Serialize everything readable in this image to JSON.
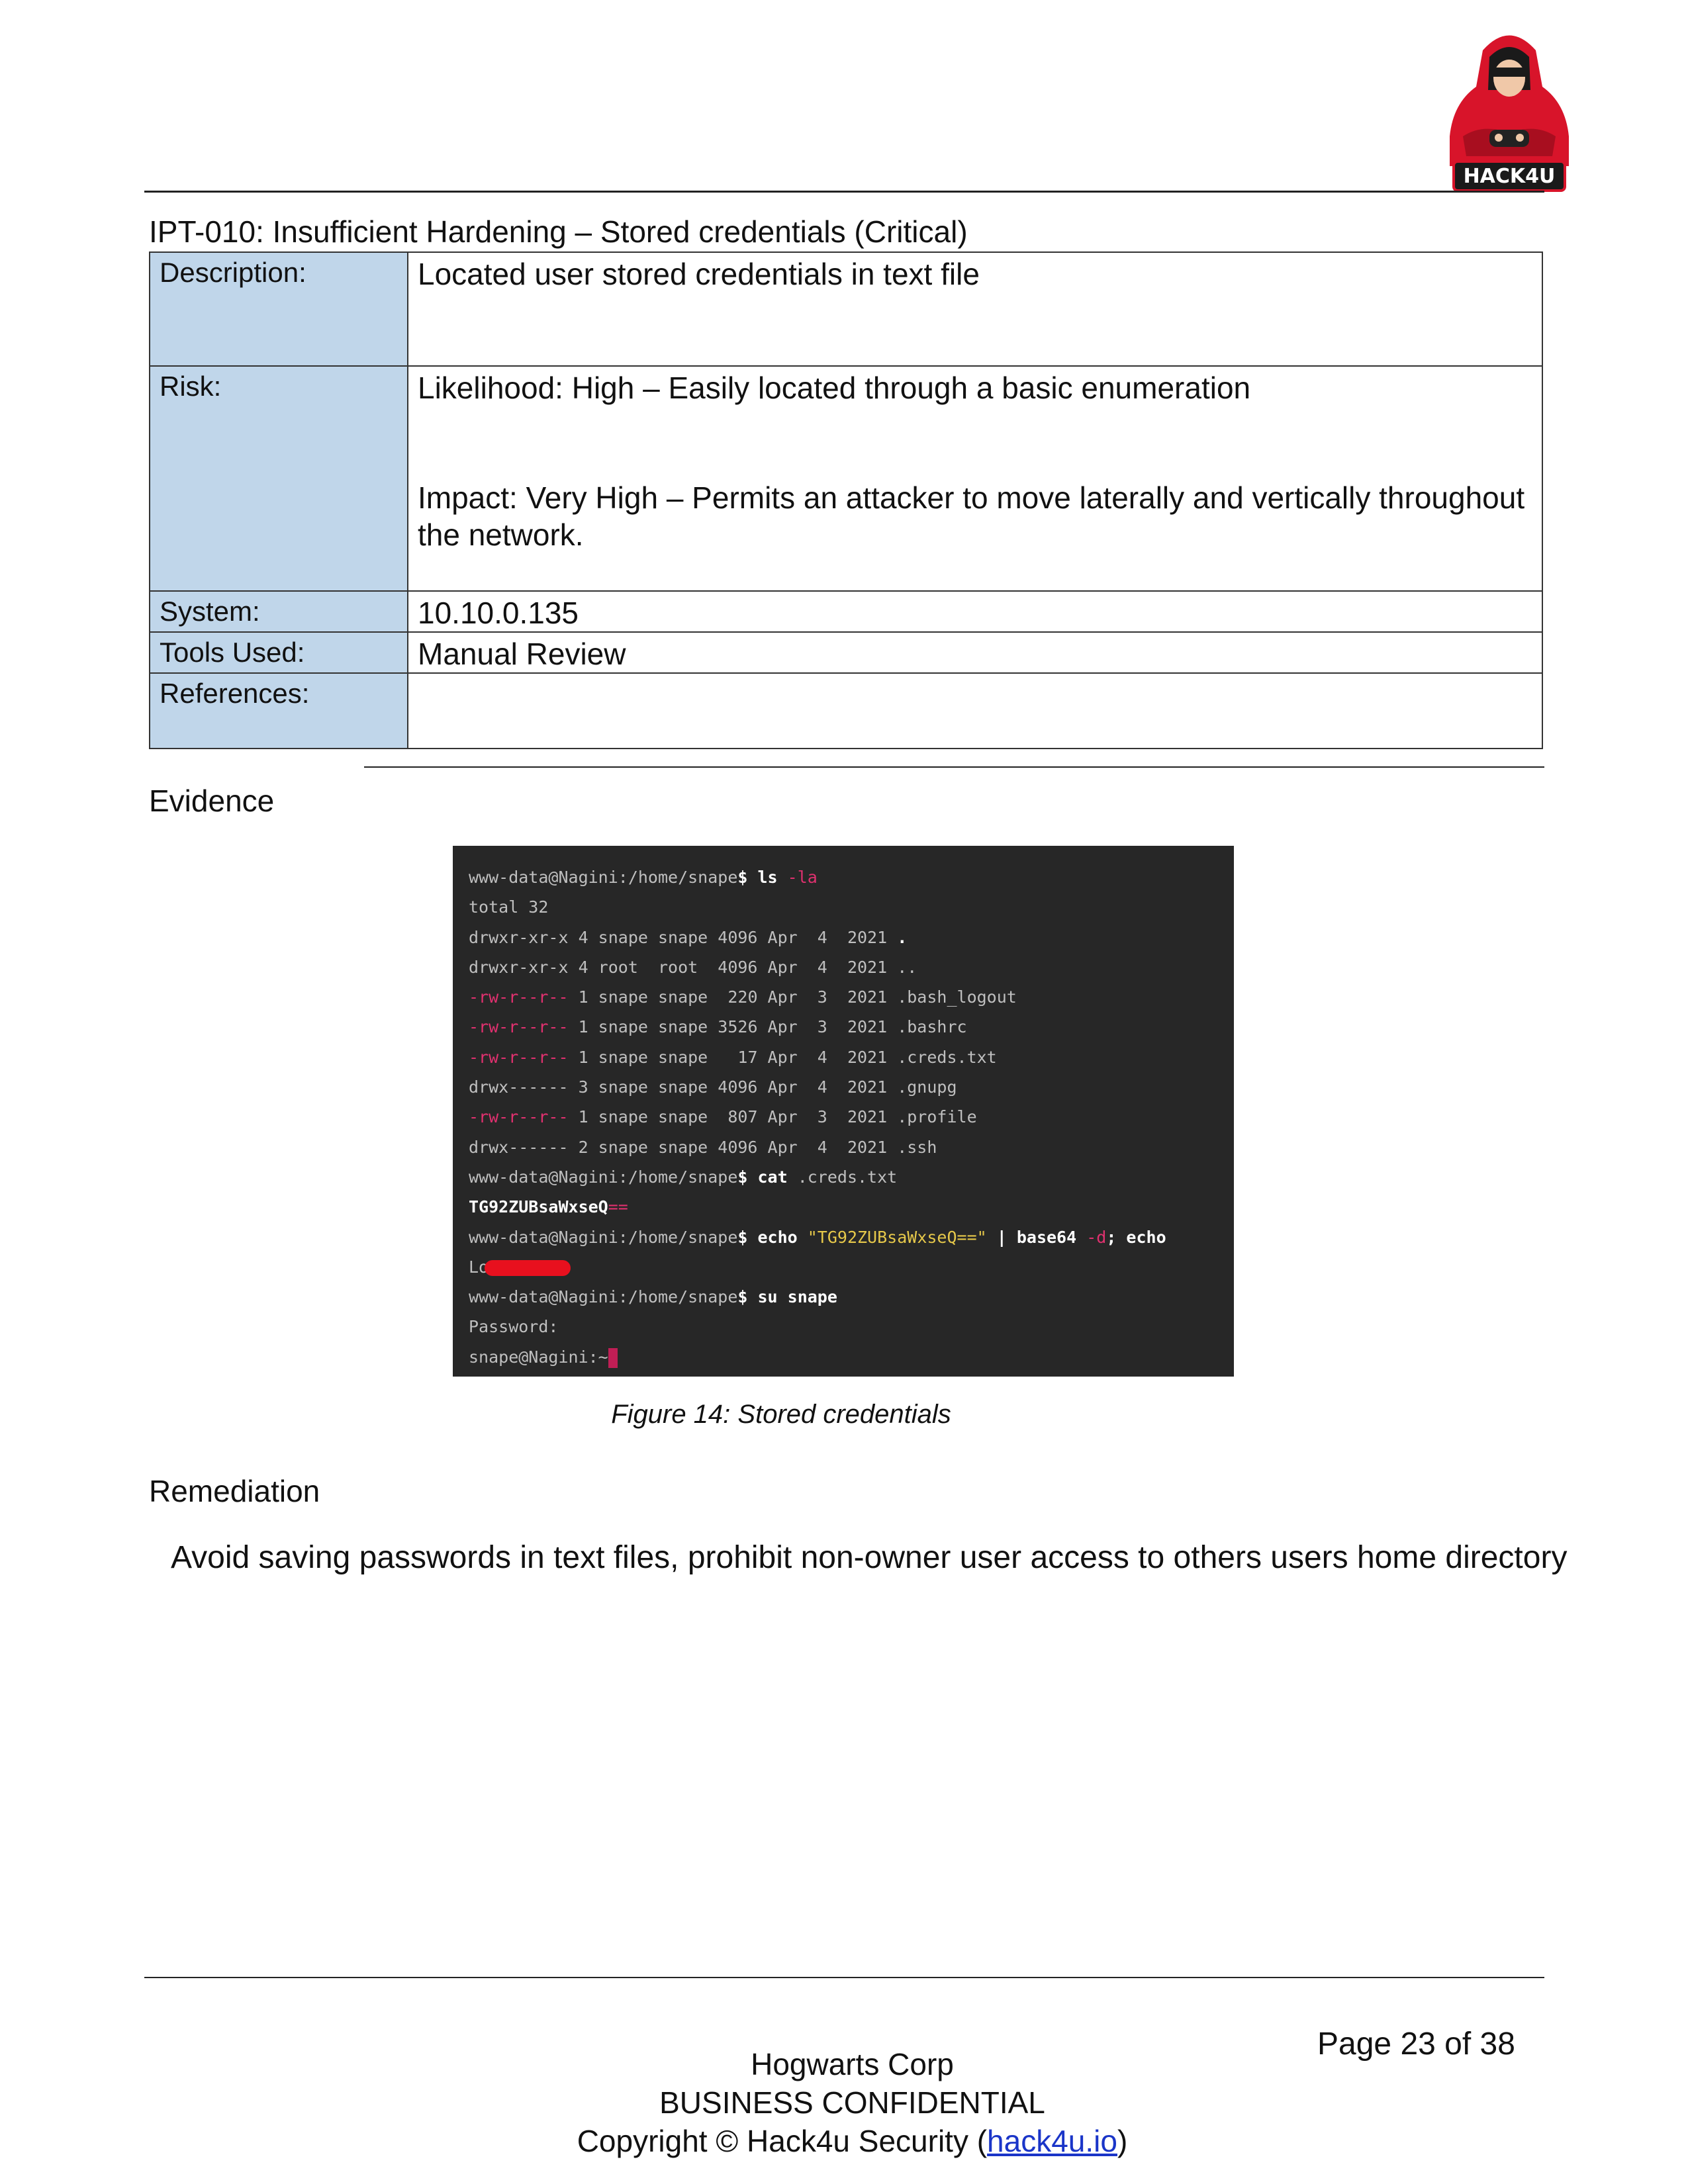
{
  "logo": {
    "text": "HACK4U"
  },
  "finding": {
    "title": "IPT-010: Insufficient Hardening – Stored credentials (Critical)",
    "rows": {
      "description": {
        "label": "Description:",
        "value": "Located user stored credentials in text file"
      },
      "risk": {
        "label": "Risk:",
        "likelihood": "Likelihood: High – Easily located through a basic enumeration",
        "impact": "Impact: Very High – Permits an attacker to move laterally and vertically throughout the network."
      },
      "system": {
        "label": "System:",
        "value": "10.10.0.135"
      },
      "tools": {
        "label": "Tools Used:",
        "value": "Manual Review"
      },
      "references": {
        "label": "References:",
        "value": ""
      }
    }
  },
  "evidence": {
    "heading": "Evidence"
  },
  "terminal": {
    "lines": [
      [
        {
          "t": "www-data@Nagini:/home/snape",
          "c": ""
        },
        {
          "t": "$ ls ",
          "c": "bold"
        },
        {
          "t": "-la",
          "c": "pink"
        }
      ],
      [
        {
          "t": "total 32",
          "c": ""
        }
      ],
      [
        {
          "t": "drwxr-xr-x 4 snape snape 4096 Apr  4  2021 ",
          "c": ""
        },
        {
          "t": ".",
          "c": "bold"
        }
      ],
      [
        {
          "t": "drwxr-xr-x 4 root  root  4096 Apr  4  2021 ..",
          "c": ""
        }
      ],
      [
        {
          "t": "-rw-r--r--",
          "c": "pink"
        },
        {
          "t": " 1 snape snape  220 Apr  3  2021 .bash_logout",
          "c": ""
        }
      ],
      [
        {
          "t": "-rw-r--r--",
          "c": "pink"
        },
        {
          "t": " 1 snape snape 3526 Apr  3  2021 .bashrc",
          "c": ""
        }
      ],
      [
        {
          "t": "-rw-r--r--",
          "c": "pink"
        },
        {
          "t": " 1 snape snape   17 Apr  4  2021 .creds.txt",
          "c": ""
        }
      ],
      [
        {
          "t": "drwx------ 3 snape snape 4096 Apr  4  2021 .gnupg",
          "c": ""
        }
      ],
      [
        {
          "t": "-rw-r--r--",
          "c": "pink"
        },
        {
          "t": " 1 snape snape  807 Apr  3  2021 .profile",
          "c": ""
        }
      ],
      [
        {
          "t": "drwx------ 2 snape snape 4096 Apr  4  2021 .ssh",
          "c": ""
        }
      ],
      [
        {
          "t": "www-data@Nagini:/home/snape",
          "c": ""
        },
        {
          "t": "$ cat ",
          "c": "bold"
        },
        {
          "t": ".creds.txt",
          "c": ""
        }
      ],
      [
        {
          "t": "TG92ZUBsaWxseQ",
          "c": "bold"
        },
        {
          "t": "==",
          "c": "pink"
        }
      ],
      [
        {
          "t": "www-data@Nagini:/home/snape",
          "c": ""
        },
        {
          "t": "$ echo ",
          "c": "bold"
        },
        {
          "t": "\"TG92ZUBsaWxseQ==\"",
          "c": "yellow"
        },
        {
          "t": " | base64 ",
          "c": "bold"
        },
        {
          "t": "-d",
          "c": "pink"
        },
        {
          "t": "; echo",
          "c": "bold"
        }
      ],
      [
        {
          "t": "Lo",
          "c": ""
        },
        {
          "t": "",
          "c": "redact"
        }
      ],
      [
        {
          "t": "www-data@Nagini:/home/snape",
          "c": ""
        },
        {
          "t": "$ su snape",
          "c": "bold"
        }
      ],
      [
        {
          "t": "Password:",
          "c": ""
        }
      ],
      [
        {
          "t": "snape@Nagini:~",
          "c": ""
        },
        {
          "t": "",
          "c": "cursor"
        }
      ]
    ]
  },
  "figure": {
    "caption": "Figure 14: Stored credentials"
  },
  "remediation": {
    "heading": "Remediation",
    "text": "Avoid saving passwords in text files, prohibit non-owner user access to others users home directory"
  },
  "footer": {
    "page": "Page 23 of 38",
    "company": "Hogwarts Corp",
    "confidential": "BUSINESS CONFIDENTIAL",
    "copyright_prefix": "Copyright © Hack4u Security (",
    "link": "hack4u.io",
    "copyright_suffix": ")"
  },
  "colors": {
    "label_bg": "#c0d6ea",
    "terminal_bg": "#272727",
    "accent_pink": "#e0316f",
    "accent_yellow": "#e6c84a",
    "link": "#1a35c8"
  }
}
